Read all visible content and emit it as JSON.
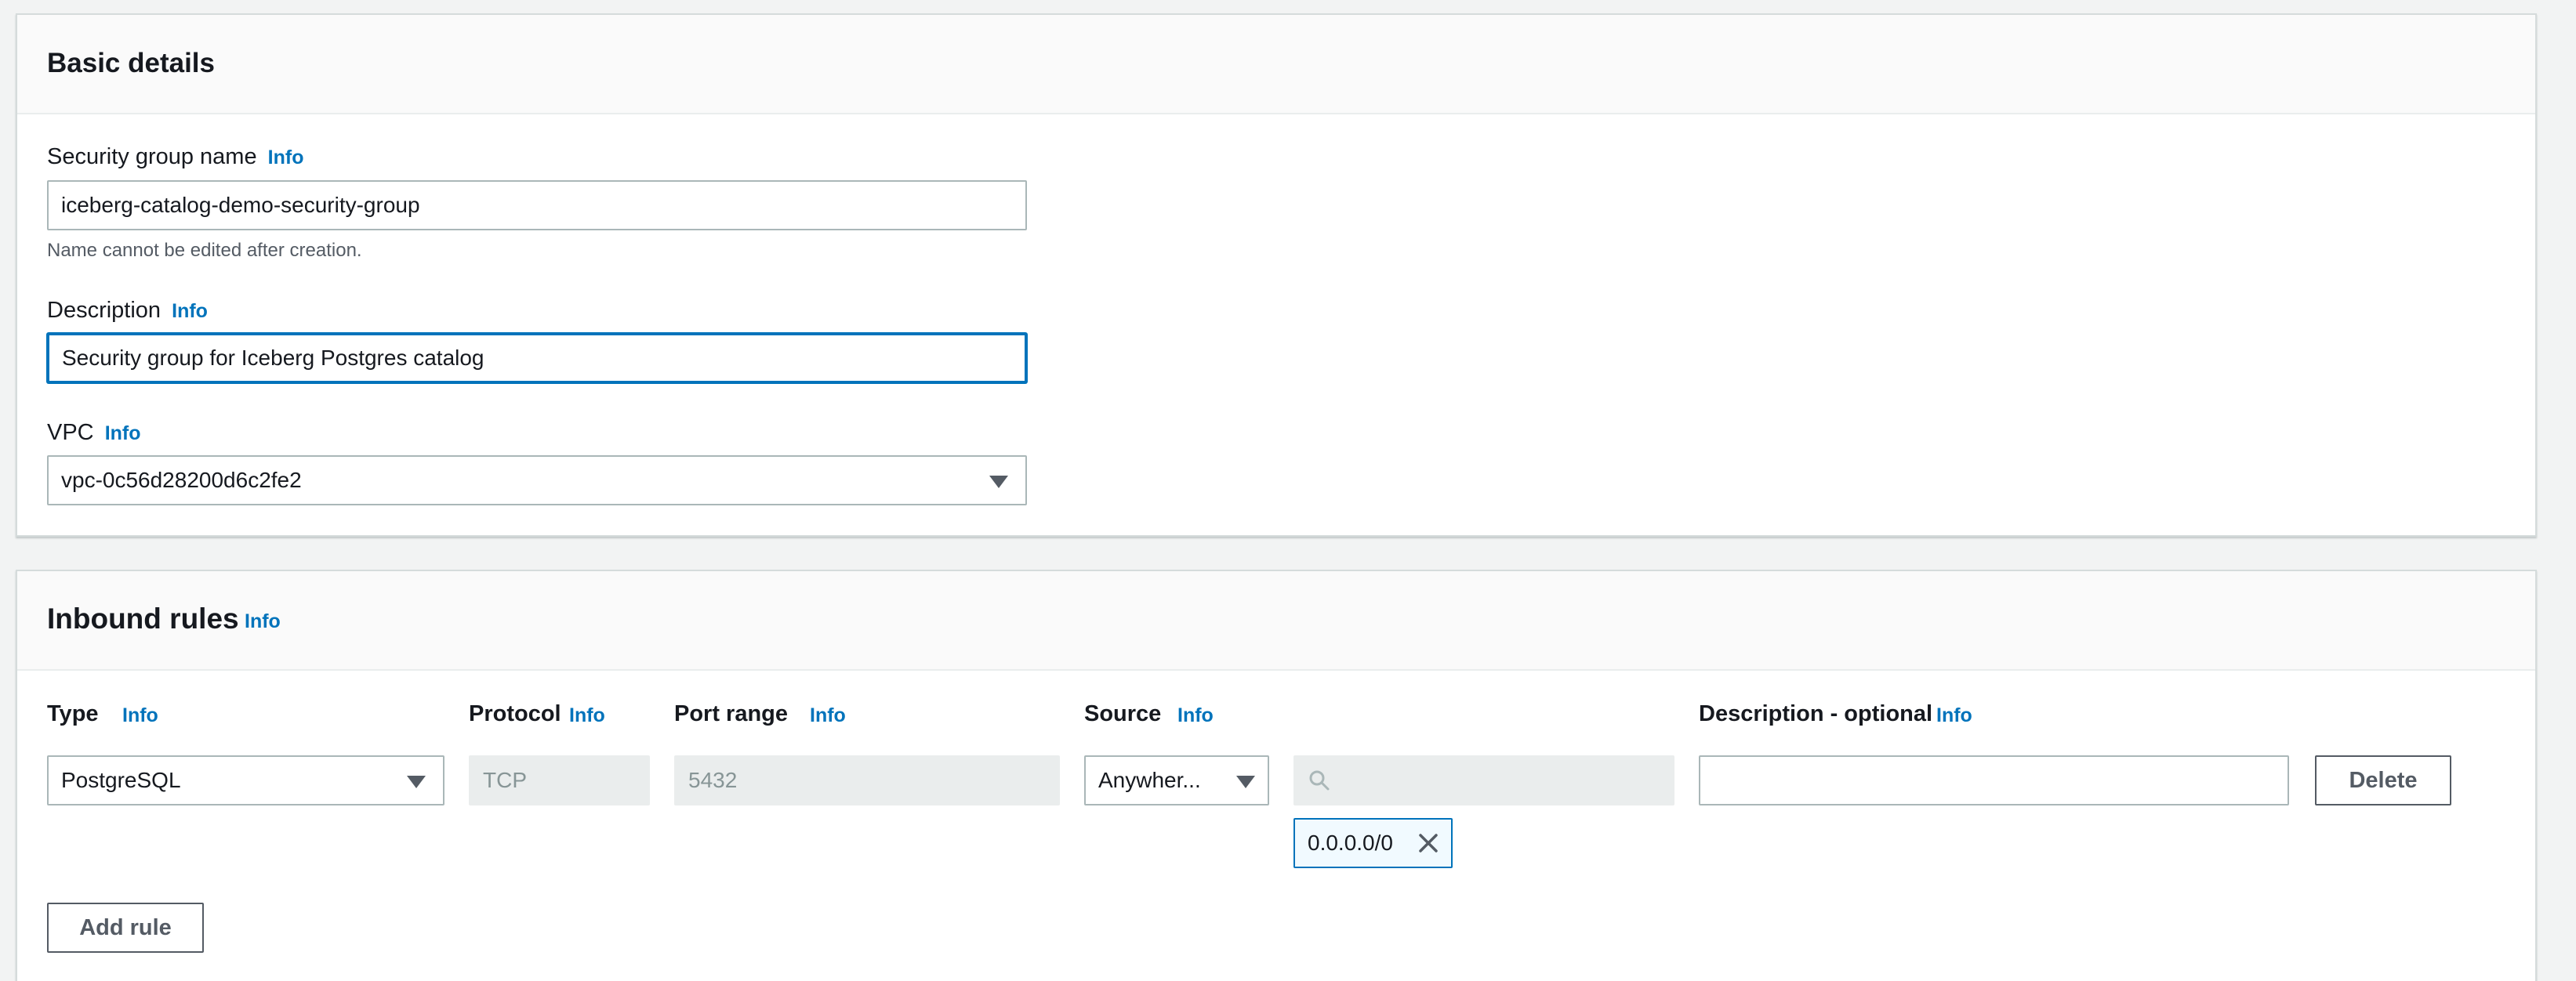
{
  "basic_details": {
    "title": "Basic details",
    "name_field": {
      "label": "Security group name",
      "info": "Info",
      "value": "iceberg-catalog-demo-security-group",
      "hint": "Name cannot be edited after creation."
    },
    "description_field": {
      "label": "Description",
      "info": "Info",
      "value": "Security group for Iceberg Postgres catalog"
    },
    "vpc_field": {
      "label": "VPC",
      "info": "Info",
      "value": "vpc-0c56d28200d6c2fe2"
    }
  },
  "inbound_rules": {
    "title": "Inbound rules",
    "info": "Info",
    "columns": {
      "type": "Type",
      "protocol": "Protocol",
      "port_range": "Port range",
      "source": "Source",
      "description": "Description - optional",
      "info": "Info"
    },
    "rule": {
      "type": "PostgreSQL",
      "protocol": "TCP",
      "port_range": "5432",
      "source": "Anywher...",
      "source_search": "",
      "source_token": "0.0.0.0/0",
      "description": "",
      "delete_label": "Delete"
    },
    "add_rule_label": "Add rule"
  },
  "icons": {
    "dropdown": "caret-down-icon",
    "search": "search-icon",
    "remove_token": "close-icon"
  },
  "colors": {
    "link": "#0073bb",
    "focus": "#0073bb",
    "background": "#f2f3f3"
  }
}
